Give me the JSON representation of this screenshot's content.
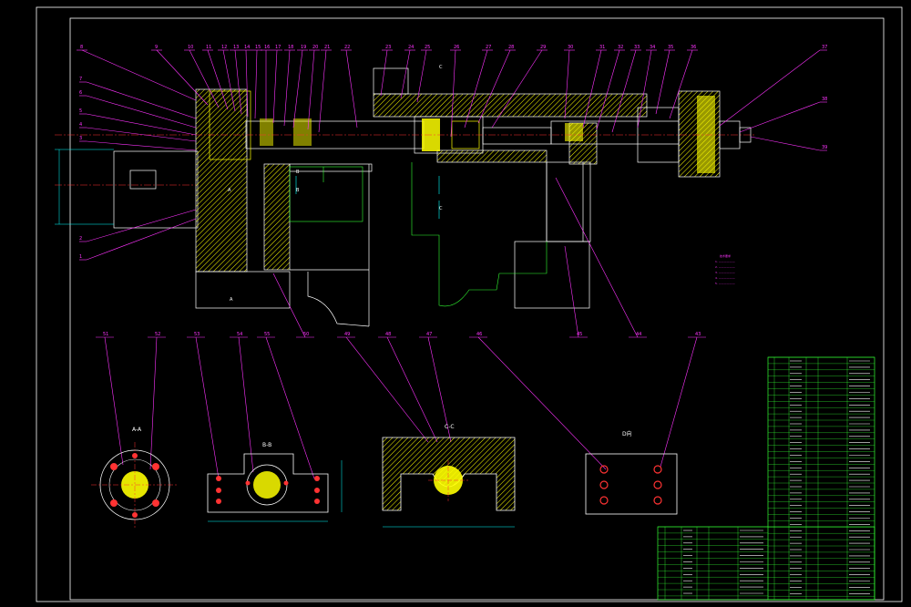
{
  "drawing": {
    "background": "#000000",
    "colors": {
      "frame": "#ffffff",
      "outline": "#ffffff",
      "hatch": "#ffff00",
      "leader": "#ff33ff",
      "center": "#ff3333",
      "dimension": "#00ffff",
      "hidden": "#33ff33",
      "table_grid": "#33ff33",
      "blue": "#3366ff"
    },
    "section_marks": [
      "A",
      "B",
      "C",
      "A",
      "B",
      "C"
    ],
    "view_titles": {
      "view_a": "A-A",
      "view_b": "B-B",
      "view_c": "C-C",
      "view_d": "D向"
    },
    "leader_labels_top": [
      "8",
      "9",
      "10",
      "11",
      "12",
      "13",
      "14",
      "15",
      "16",
      "17",
      "18",
      "19",
      "20",
      "21",
      "22",
      "23",
      "24",
      "25",
      "26",
      "27",
      "28",
      "29",
      "30",
      "31",
      "32",
      "33",
      "34",
      "35",
      "36"
    ],
    "leader_labels_left": [
      "7",
      "6",
      "5",
      "4",
      "3",
      "2",
      "1"
    ],
    "leader_labels_right": [
      "37",
      "38",
      "39"
    ],
    "leader_labels_bottom": [
      "51",
      "52",
      "53",
      "54",
      "55",
      "50",
      "49",
      "48",
      "47",
      "46",
      "45",
      "44",
      "43"
    ],
    "notes_title": "技术要求",
    "notes": [
      "1. ——————",
      "2. ——————",
      "3. ——————",
      "4. ——————",
      "5. ——————"
    ]
  }
}
